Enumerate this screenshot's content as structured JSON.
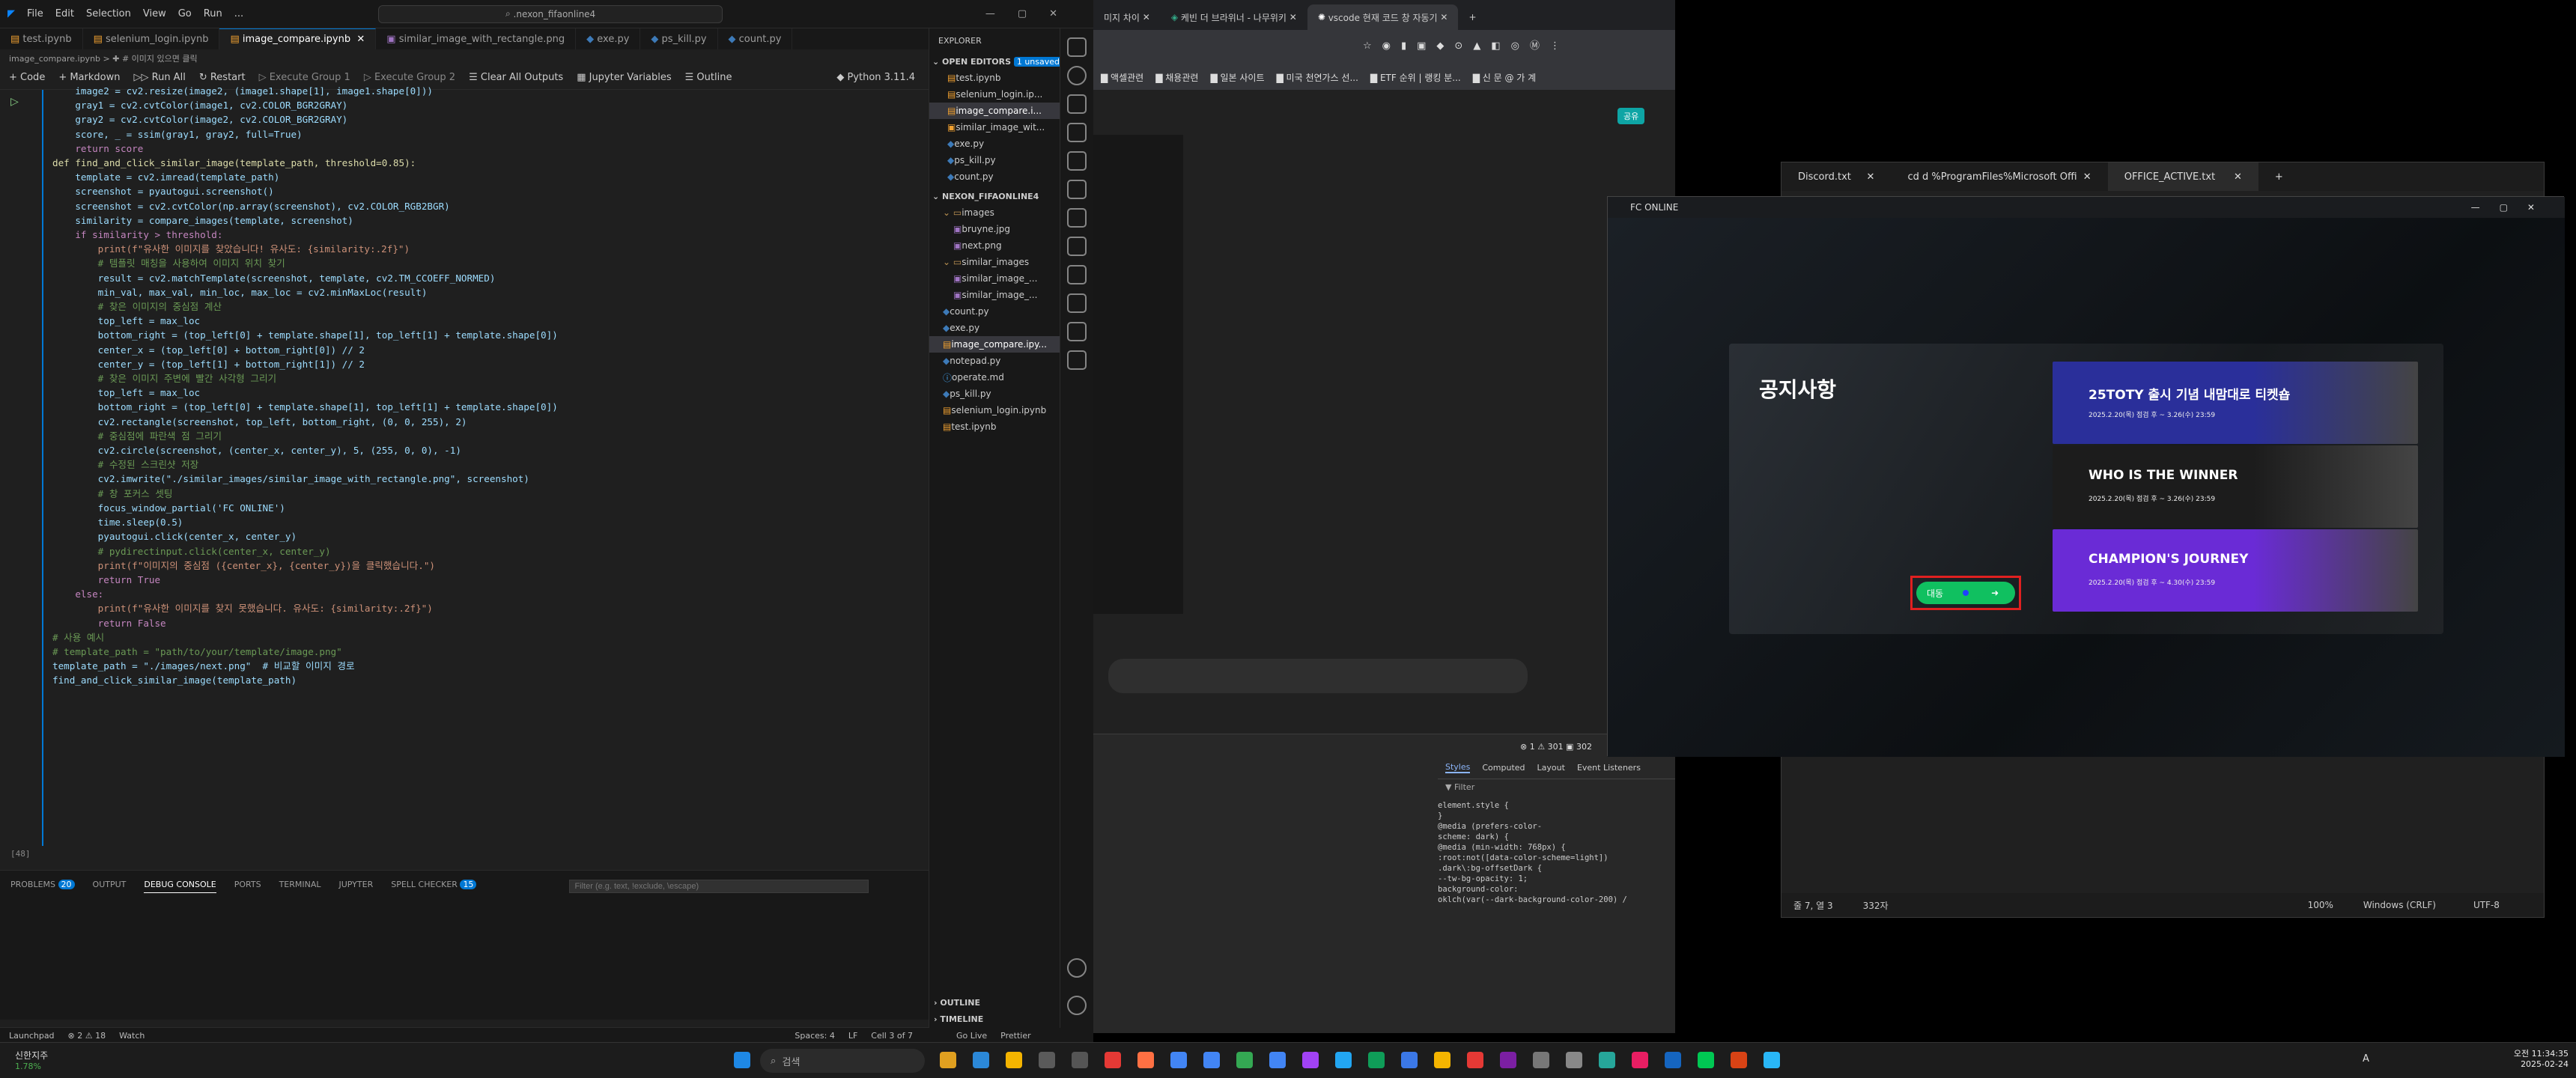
{
  "vscode": {
    "menu": [
      "File",
      "Edit",
      "Selection",
      "View",
      "Go",
      "Run",
      "..."
    ],
    "search_text": ".nexon_fifaonline4",
    "tabs": [
      "test.ipynb",
      "selenium_login.ipynb",
      "image_compare.ipynb",
      "similar_image_with_rectangle.png",
      "exe.py",
      "ps_kill.py",
      "count.py"
    ],
    "breadcrumb": "image_compare.ipynb > ✚ # 이미지 있으면 클릭",
    "toolbar": [
      "Code",
      "Markdown",
      "Run All",
      "Restart",
      "Execute Group 1",
      "Execute Group 2",
      "Clear All Outputs",
      "Jupyter Variables",
      "Outline"
    ],
    "kernel": "Python 3.11.4",
    "cell_label": "[48]",
    "code_lines": [
      "    image2 = cv2.resize(image2, (image1.shape[1], image1.shape[0]))",
      "    gray1 = cv2.cvtColor(image1, cv2.COLOR_BGR2GRAY)",
      "    gray2 = cv2.cvtColor(image2, cv2.COLOR_BGR2GRAY)",
      "    score, _ = ssim(gray1, gray2, full=True)",
      "    return score",
      "",
      "def find_and_click_similar_image(template_path, threshold=0.85):",
      "    template = cv2.imread(template_path)",
      "    screenshot = pyautogui.screenshot()",
      "    screenshot = cv2.cvtColor(np.array(screenshot), cv2.COLOR_RGB2BGR)",
      "",
      "    similarity = compare_images(template, screenshot)",
      "",
      "    if similarity > threshold:",
      "        print(f\"유사한 이미지를 찾았습니다! 유사도: {similarity:.2f}\")",
      "",
      "        # 템플릿 매칭을 사용하여 이미지 위치 찾기",
      "        result = cv2.matchTemplate(screenshot, template, cv2.TM_CCOEFF_NORMED)",
      "        min_val, max_val, min_loc, max_loc = cv2.minMaxLoc(result)",
      "",
      "        # 찾은 이미지의 중심점 계산",
      "        top_left = max_loc",
      "        bottom_right = (top_left[0] + template.shape[1], top_left[1] + template.shape[0])",
      "        center_x = (top_left[0] + bottom_right[0]) // 2",
      "        center_y = (top_left[1] + bottom_right[1]) // 2",
      "",
      "        # 찾은 이미지 주변에 빨간 사각형 그리기",
      "        top_left = max_loc",
      "        bottom_right = (top_left[0] + template.shape[1], top_left[1] + template.shape[0])",
      "        cv2.rectangle(screenshot, top_left, bottom_right, (0, 0, 255), 2)",
      "",
      "        # 중심점에 파란색 점 그리기",
      "        cv2.circle(screenshot, (center_x, center_y), 5, (255, 0, 0), -1)",
      "",
      "        # 수정된 스크린샷 저장",
      "        cv2.imwrite(\"./similar_images/similar_image_with_rectangle.png\", screenshot)",
      "",
      "        # 창 포커스 셋팅",
      "        focus_window_partial('FC ONLINE')",
      "        time.sleep(0.5)",
      "        pyautogui.click(center_x, center_y)",
      "        # pydirectinput.click(center_x, center_y)",
      "        print(f\"이미지의 중심점 ({center_x}, {center_y})을 클릭했습니다.\")",
      "",
      "        return True",
      "    else:",
      "        print(f\"유사한 이미지를 찾지 못했습니다. 유사도: {similarity:.2f}\")",
      "        return False",
      "",
      "# 사용 예시",
      "# template_path = \"path/to/your/template/image.png\"",
      "template_path = \"./images/next.png\"  # 비교할 이미지 경로",
      "find_and_click_similar_image(template_path)"
    ],
    "panel_tabs": [
      "PROBLEMS",
      "OUTPUT",
      "DEBUG CONSOLE",
      "PORTS",
      "TERMINAL",
      "JUPYTER",
      "SPELL CHECKER"
    ],
    "panel_filter_placeholder": "Filter (e.g. text, !exclude, \\escape)",
    "status_left": [
      "Launchpad",
      "⊗ 2 ⚠ 18",
      "Watch"
    ],
    "status_right": [
      "Spaces: 4",
      "LF",
      "Cell 3 of 7",
      "Go Live",
      "Prettier"
    ]
  },
  "explorer": {
    "title": "EXPLORER",
    "open_editors_label": "OPEN EDITORS",
    "unsaved_badge": "1 unsaved",
    "open_editors": [
      "test.ipynb",
      "selenium_login.ip...",
      "image_compare.i...",
      "similar_image_wit...",
      "exe.py",
      "ps_kill.py",
      "count.py"
    ],
    "project": "NEXON_FIFAONLINE4",
    "tree": [
      "images",
      "bruyne.jpg",
      "next.png",
      "similar_images",
      "similar_image_...",
      "similar_image_...",
      "count.py",
      "exe.py",
      "image_compare.ipy...",
      "notepad.py",
      "operate.md",
      "ps_kill.py",
      "selenium_login.ipynb",
      "test.ipynb"
    ],
    "outline": "OUTLINE",
    "timeline": "TIMELINE"
  },
  "chrome": {
    "tabs": [
      "미지 차이",
      "케빈 더 브라위너 - 나무위키",
      "vscode 현재 코드 창 자동기"
    ],
    "bookmarks": [
      "액셀관련",
      "채용관련",
      "일본 사이트",
      "미국 천연가스 선...",
      "ETF 순위 | 랭킹 분...",
      "신 문 @ 가 계"
    ],
    "share_label": "공유",
    "devtools_tabs": [
      "Styles",
      "Computed",
      "Layout",
      "Event Listeners"
    ],
    "devtools_counts": "⊗ 1  ⚠ 301  ▣ 302",
    "filter_label": "Filter",
    "style_lines": [
      "element.style {",
      "}",
      "@media (prefers-color-",
      "scheme: dark) {",
      "@media (min-width: 768px) {",
      ":root:not([data-color-scheme=light])",
      ".dark\\:bg-offsetDark {",
      "--tw-bg-opacity: 1;",
      "background-color:",
      "oklch(var(--dark-background-color-200) /"
    ]
  },
  "notepad": {
    "tabs": [
      "Discord.txt",
      "cd d %ProgramFiles%Microsoft Offi",
      "OFFICE_ACTIVE.txt"
    ],
    "status": [
      "줄 7, 열 3",
      "332자",
      "100%",
      "Windows (CRLF)",
      "UTF-8"
    ]
  },
  "fc_online": {
    "title": "FC ONLINE",
    "notice_title": "공지사항",
    "next_button": "대동",
    "banners": [
      {
        "title": "25TOTY 출시 기념 내맘대로 티켓숍",
        "date": "2025.2.20(목) 점검 후 ~ 3.26(수) 23:59",
        "color": "#2a2f9a"
      },
      {
        "title": "WHO IS THE WINNER",
        "date": "2025.2.20(목) 점검 후 ~ 3.26(수) 23:59",
        "color": "#1c1c1c"
      },
      {
        "title": "CHAMPION'S JOURNEY",
        "date": "2025.2.20(목) 점검 후 ~ 4.30(수) 23:59",
        "color": "#6a2bd6"
      }
    ]
  },
  "taskbar": {
    "weather_title": "신한지주",
    "weather_value": "1.78%",
    "search_placeholder": "검색",
    "time": "오전 11:34:35",
    "date": "2025-02-24",
    "lang": "A"
  }
}
